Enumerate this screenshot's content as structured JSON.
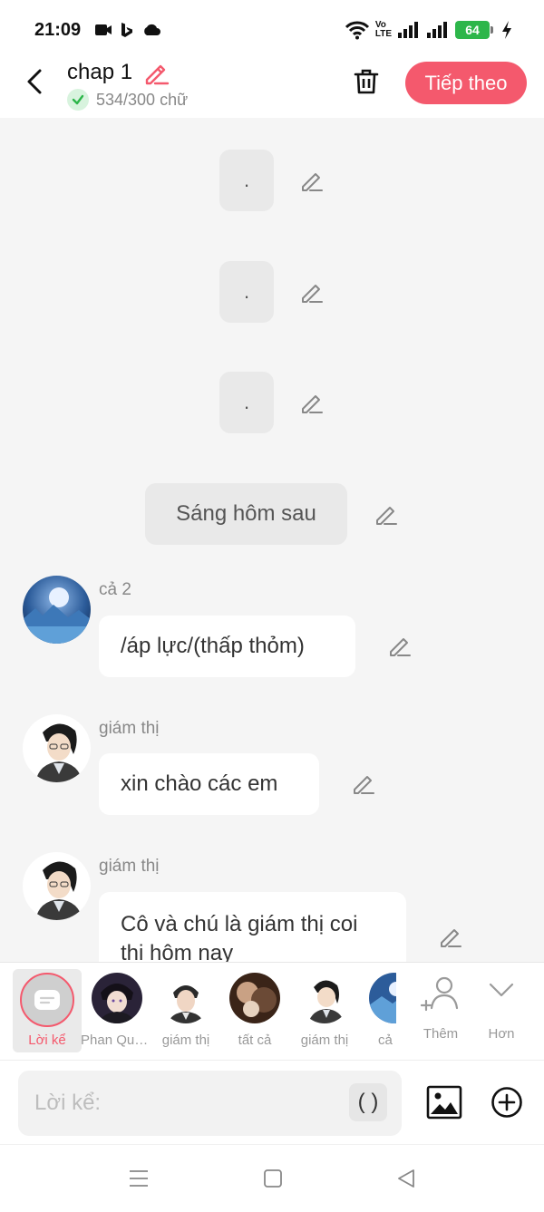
{
  "status_bar": {
    "time": "21:09",
    "volte_top": "Vo",
    "volte_bottom": "LTE",
    "battery": "64"
  },
  "header": {
    "title": "chap 1",
    "word_count": "534/300 chữ",
    "next_button": "Tiếp theo"
  },
  "chat": {
    "dot_bubbles": [
      ".",
      ".",
      "."
    ],
    "narration": "Sáng hôm sau",
    "messages": [
      {
        "speaker": "cả 2",
        "text": "/áp lực/(thấp thỏm)"
      },
      {
        "speaker": "giám thị",
        "text": "xin chào các em"
      },
      {
        "speaker": "giám thị",
        "text": "Cô và chú là giám thị coi thi hôm nay"
      }
    ]
  },
  "character_bar": {
    "narrator_label": "Lời kể",
    "characters": [
      {
        "name": "Phan Quố..."
      },
      {
        "name": "giám thị"
      },
      {
        "name": "tất cả"
      },
      {
        "name": "giám thị"
      },
      {
        "name": "cả"
      }
    ],
    "add_label": "Thêm",
    "more_label": "Hơn"
  },
  "input": {
    "placeholder": "Lời kể:",
    "paren_label": "( )"
  },
  "colors": {
    "accent": "#f4596d",
    "chat_background": "#f5f5f5",
    "battery": "#2db64a"
  }
}
